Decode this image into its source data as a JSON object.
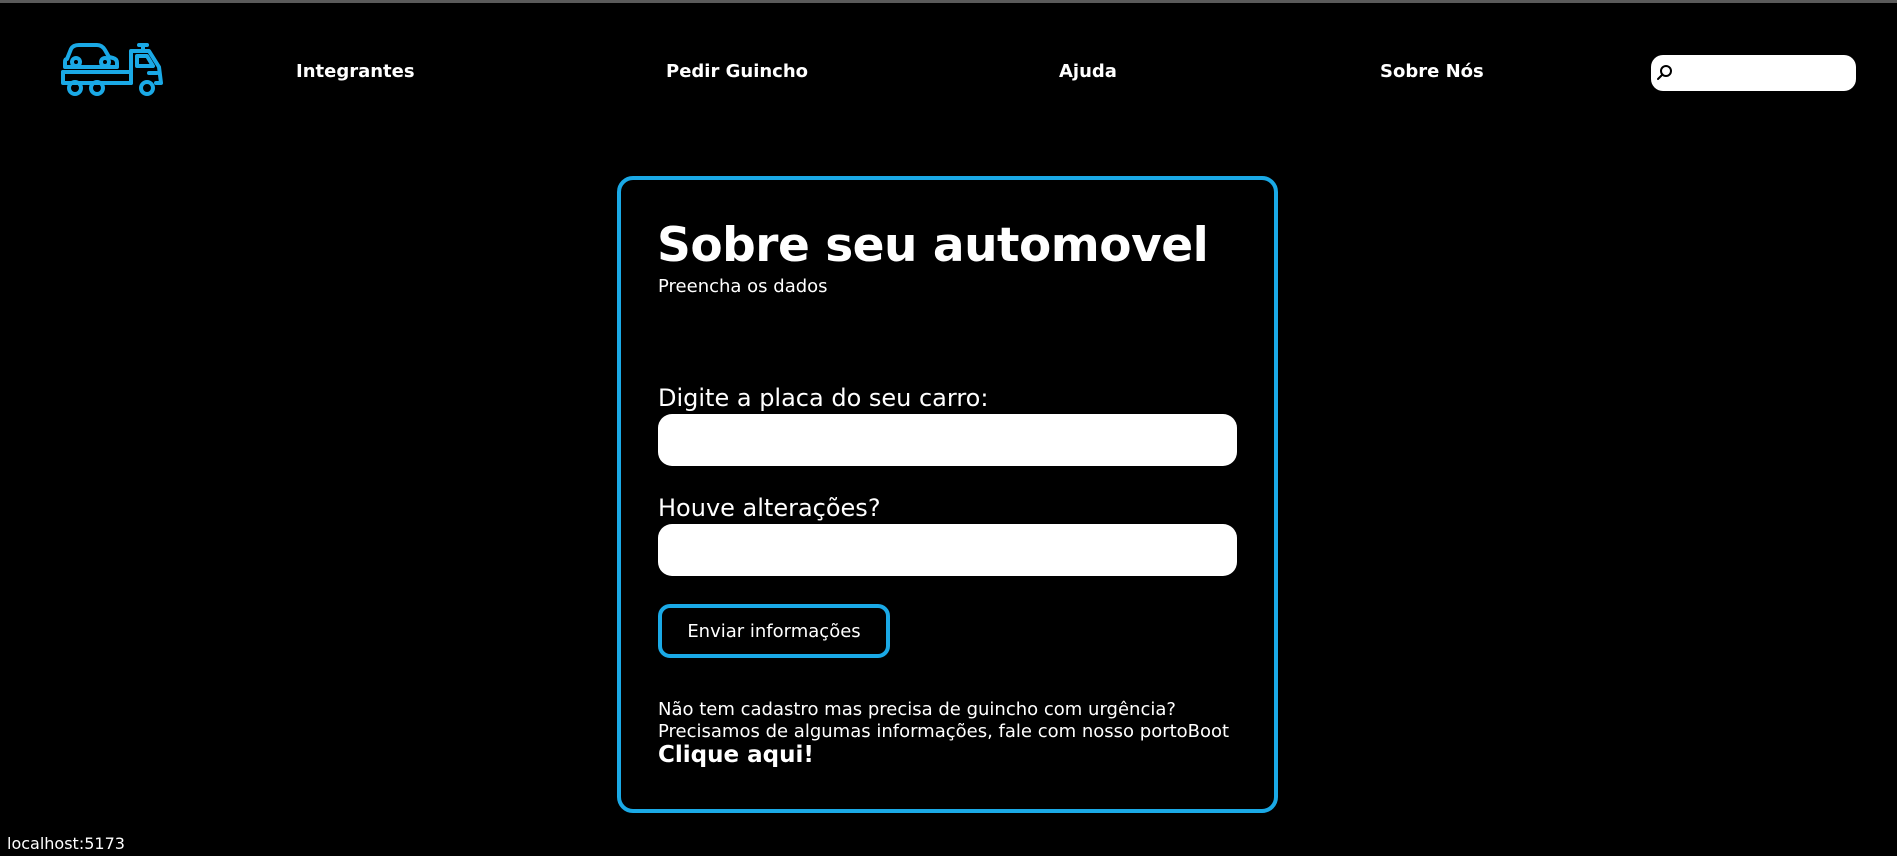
{
  "colors": {
    "background": "#000000",
    "accent": "#1aa9e6",
    "text": "#ffffff",
    "input_background": "#ffffff"
  },
  "header": {
    "logo_icon": "tow-truck-icon",
    "nav": [
      {
        "label": "Integrantes"
      },
      {
        "label": "Pedir Guincho"
      },
      {
        "label": "Ajuda"
      },
      {
        "label": "Sobre Nós"
      }
    ],
    "search": {
      "icon": "search-icon",
      "value": "",
      "placeholder": ""
    }
  },
  "form": {
    "title": "Sobre seu automovel",
    "subtitle": "Preencha os dados",
    "fields": [
      {
        "label": "Digite a placa do seu carro:",
        "value": "",
        "placeholder": ""
      },
      {
        "label": "Houve alterações?",
        "value": "",
        "placeholder": ""
      }
    ],
    "submit_label": "Enviar informações",
    "note_line1": "Não tem cadastro mas precisa de guincho com urgência?",
    "note_line2": "Precisamos de algumas informações, fale com nosso portoBoot",
    "cta_label": "Clique aqui!"
  },
  "status_bar": {
    "url": "localhost:5173"
  }
}
